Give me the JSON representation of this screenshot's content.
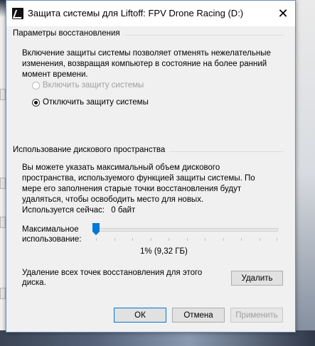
{
  "window": {
    "title": "Защита системы для Liftoff: FPV Drone Racing (D:)",
    "close_symbol": "✕"
  },
  "restore_settings": {
    "group_title": "Параметры восстановления",
    "description": "Включение защиты системы позволяет отменять нежелательные изменения, возвращая компьютер в состояние на более ранний момент времени.",
    "option_enable": "Включить защиту системы",
    "option_disable": "Отключить защиту системы",
    "selected": "disable"
  },
  "disk_usage": {
    "group_title": "Использование дискового пространства",
    "description": "Вы можете указать максимальный объем дискового пространства, используемого функцией защиты системы. По мере его заполнения старые точки восстановления будут удаляться, чтобы освободить место для новых.",
    "current_label": "Используется сейчас:",
    "current_value": "0 байт",
    "max_label_line1": "Максимальное",
    "max_label_line2": "использование:",
    "max_percent": 0.01,
    "max_value_text": "1% (9,32 ГБ)",
    "delete_text": "Удаление всех точек восстановления для этого диска.",
    "delete_button": "Удалить"
  },
  "footer": {
    "ok": "ОК",
    "cancel": "Отмена",
    "apply": "Применить"
  },
  "colors": {
    "accent": "#0078d7"
  }
}
